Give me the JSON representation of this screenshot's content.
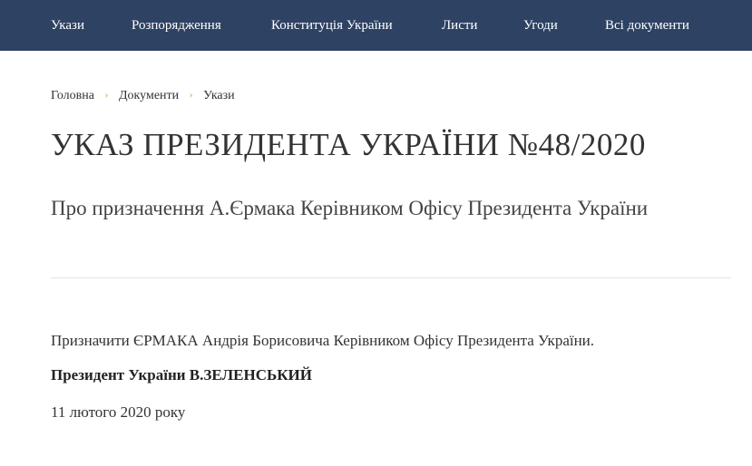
{
  "nav": {
    "items": [
      {
        "label": "Укази"
      },
      {
        "label": "Розпорядження"
      },
      {
        "label": "Конституція України"
      },
      {
        "label": "Листи"
      },
      {
        "label": "Угоди"
      },
      {
        "label": "Всі документи"
      }
    ]
  },
  "breadcrumb": {
    "items": [
      {
        "label": "Головна"
      },
      {
        "label": "Документи"
      },
      {
        "label": "Укази"
      }
    ],
    "separator_icon": "chevron-right-icon"
  },
  "document": {
    "title": "УКАЗ ПРЕЗИДЕНТА УКРАЇНИ №48/2020",
    "subtitle": "Про призначення А.Єрмака Керівником Офісу Президента України",
    "body": "Призначити ЄРМАКА Андрія Борисовича Керівником Офісу Президента України.",
    "signature": "Президент України В.ЗЕЛЕНСЬКИЙ",
    "date": "11 лютого 2020 року"
  },
  "colors": {
    "nav_background": "#2e4263",
    "breadcrumb_separator": "#d9a441",
    "divider": "#e3e3e3"
  }
}
